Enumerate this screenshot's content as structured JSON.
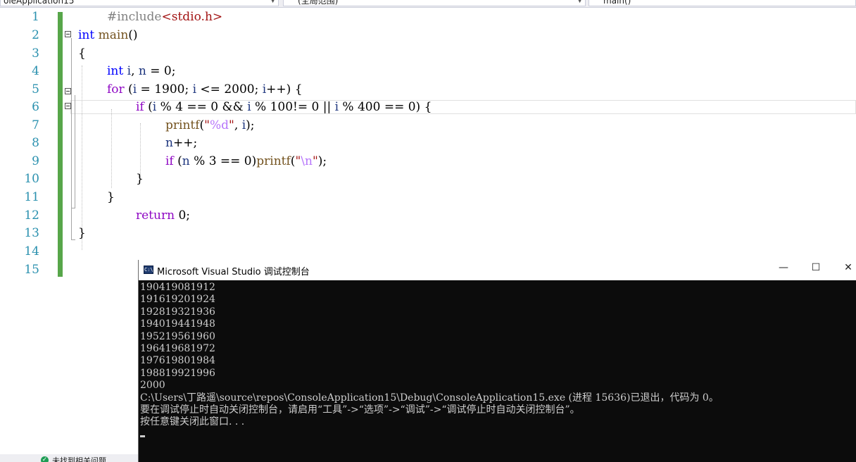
{
  "navbar": {
    "project": "oleApplication15",
    "scope": "(全局范围)",
    "member": "main()"
  },
  "editor": {
    "line_numbers": [
      "1",
      "2",
      "3",
      "4",
      "5",
      "6",
      "7",
      "8",
      "9",
      "10",
      "11",
      "12",
      "13",
      "14",
      "15"
    ],
    "colors": {
      "keyword": "#0000ff",
      "line_number": "#2b91af",
      "change_bar": "#57a64a"
    }
  },
  "status": {
    "text": "未找到相关问题"
  },
  "console": {
    "title": "Microsoft Visual Studio 调试控制台",
    "icon_label": "C:\\",
    "minimize": "—",
    "maximize": "☐",
    "close": "✕",
    "output": [
      "190419081912",
      "191619201924",
      "192819321936",
      "194019441948",
      "195219561960",
      "196419681972",
      "197619801984",
      "198819921996",
      "2000",
      "C:\\Users\\丁路遥\\source\\repos\\ConsoleApplication15\\Debug\\ConsoleApplication15.exe (进程 15636)已退出，代码为 0。",
      "要在调试停止时自动关闭控制台，请启用“工具”->“选项”->“调试”->“调试停止时自动关闭控制台”。",
      "按任意键关闭此窗口. . ."
    ]
  }
}
